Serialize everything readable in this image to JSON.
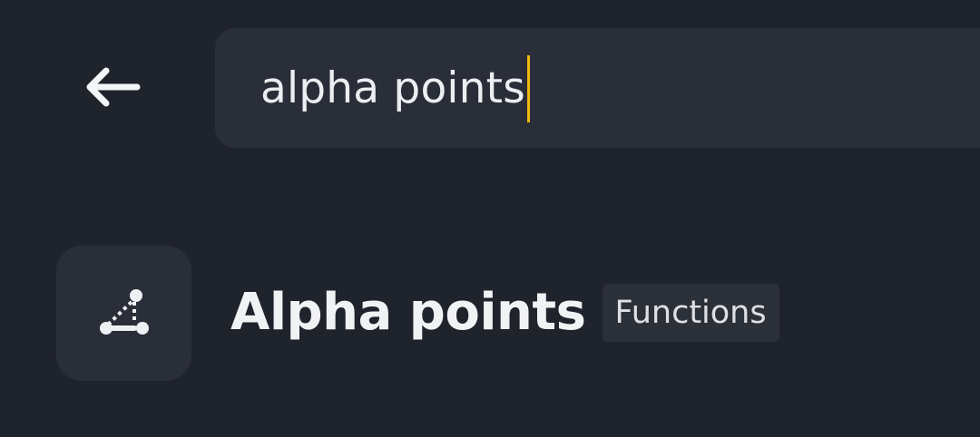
{
  "header": {
    "back_icon": "arrow-left-icon"
  },
  "search": {
    "value": "alpha points",
    "caret_color": "#f0b90b"
  },
  "results": [
    {
      "icon": "alpha-points-icon",
      "title": "Alpha points",
      "category": "Functions"
    }
  ],
  "colors": {
    "background": "#1f232c",
    "surface": "#292e38",
    "accent": "#f0b90b",
    "text": "#eef0f3"
  }
}
